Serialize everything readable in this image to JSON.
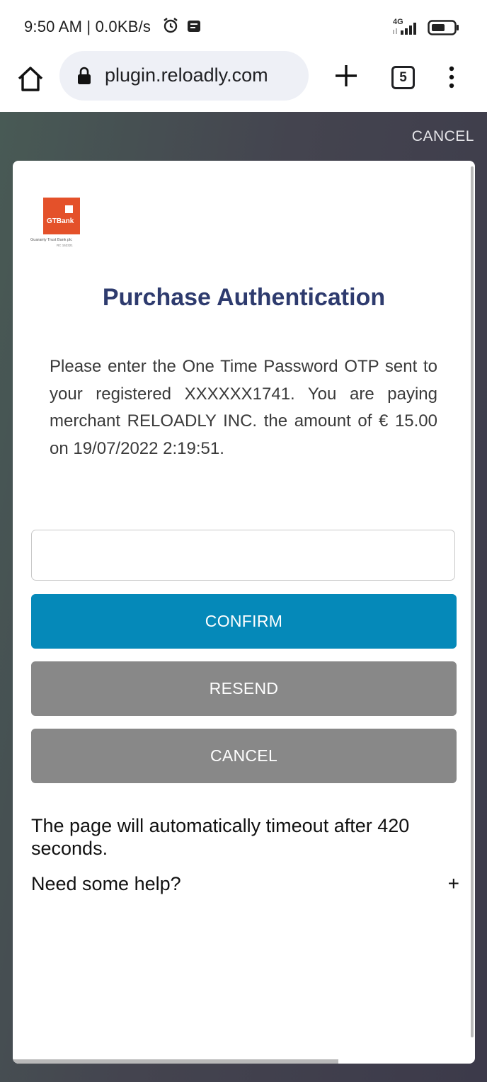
{
  "status_bar": {
    "time": "9:50 AM | 0.0KB/s",
    "network": "4G",
    "icons": [
      "alarm-icon",
      "notification-icon",
      "signal-icon",
      "battery-icon"
    ]
  },
  "browser": {
    "url": "plugin.reloadly.com",
    "tab_count": "5",
    "icons": [
      "home-icon",
      "lock-icon",
      "plus-icon",
      "menu-icon"
    ]
  },
  "page": {
    "top_cancel": "CANCEL",
    "logo": {
      "text": "GTBank",
      "subtitle": "Guaranty Trust Bank plc",
      "subtitle2": "RC 152321"
    },
    "title": "Purchase Authentication",
    "message": "Please enter the One Time Password OTP sent to your registered XXXXXX1741. You are paying merchant RELOADLY INC. the amount of € 15.00 on 19/07/2022 2:19:51.",
    "otp_value": "",
    "otp_placeholder": "",
    "buttons": {
      "confirm": "CONFIRM",
      "resend": "RESEND",
      "cancel": "CANCEL"
    },
    "timeout_text": "The page will automatically timeout after 420 seconds.",
    "help_label": "Need some help?",
    "help_toggle": "+"
  },
  "colors": {
    "title": "#2e3b6e",
    "confirm": "#0589b9",
    "secondary": "#888888",
    "logo": "#e4512a"
  }
}
